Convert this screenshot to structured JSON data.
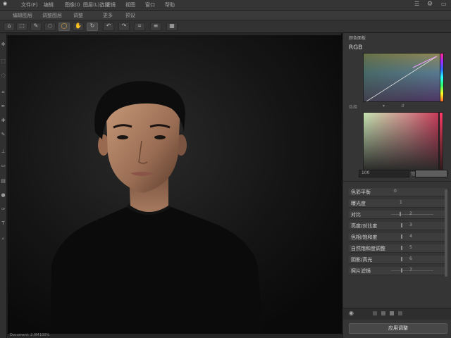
{
  "menubar": {
    "items": [
      "文件(F)",
      "编辑",
      "图像(I)",
      "图层(L)选择",
      "滤镜",
      "视图",
      "窗口",
      "帮助"
    ]
  },
  "tabbar": {
    "items": [
      "编辑图层",
      "调整图层",
      "调整",
      "更多",
      "预设"
    ]
  },
  "options": {
    "icons": [
      "home-icon",
      "select-icon",
      "brush-icon",
      "lasso-icon",
      "zoom-icon",
      "hand-icon",
      "refresh-icon",
      "undo-icon",
      "redo-icon",
      "crop-icon"
    ]
  },
  "toolbar": {
    "tools": [
      "move-tool",
      "marquee-tool",
      "lasso-tool",
      "crop-tool",
      "eyedropper-tool",
      "heal-tool",
      "brush-tool",
      "stamp-tool",
      "eraser-tool",
      "gradient-tool",
      "dodge-tool",
      "pen-tool",
      "text-tool"
    ]
  },
  "panel": {
    "title": "颜色面板",
    "rgb_label": "RGB",
    "picker1_label": "色相",
    "picker2_label": "饱和度",
    "picker2_value": "100",
    "adjustments": [
      {
        "label": "色彩平衡",
        "value": "0"
      },
      {
        "label": "曝光度",
        "value": "1"
      },
      {
        "label": "对比",
        "value": "2"
      },
      {
        "label": "亮度/对比度",
        "value": "3"
      },
      {
        "label": "色相/饱和度",
        "value": "4"
      },
      {
        "label": "自然饱和度调整",
        "value": "5"
      },
      {
        "label": "阴影/高光",
        "value": "6"
      },
      {
        "label": "照片滤镜",
        "value": "7"
      }
    ],
    "apply_label": "应用调整"
  },
  "status": {
    "left": "Document: 2.0M",
    "right": "100%"
  },
  "colors": {
    "accent": "#e6a33b",
    "panel_bg": "#353535",
    "canvas_bg": "#101010"
  }
}
